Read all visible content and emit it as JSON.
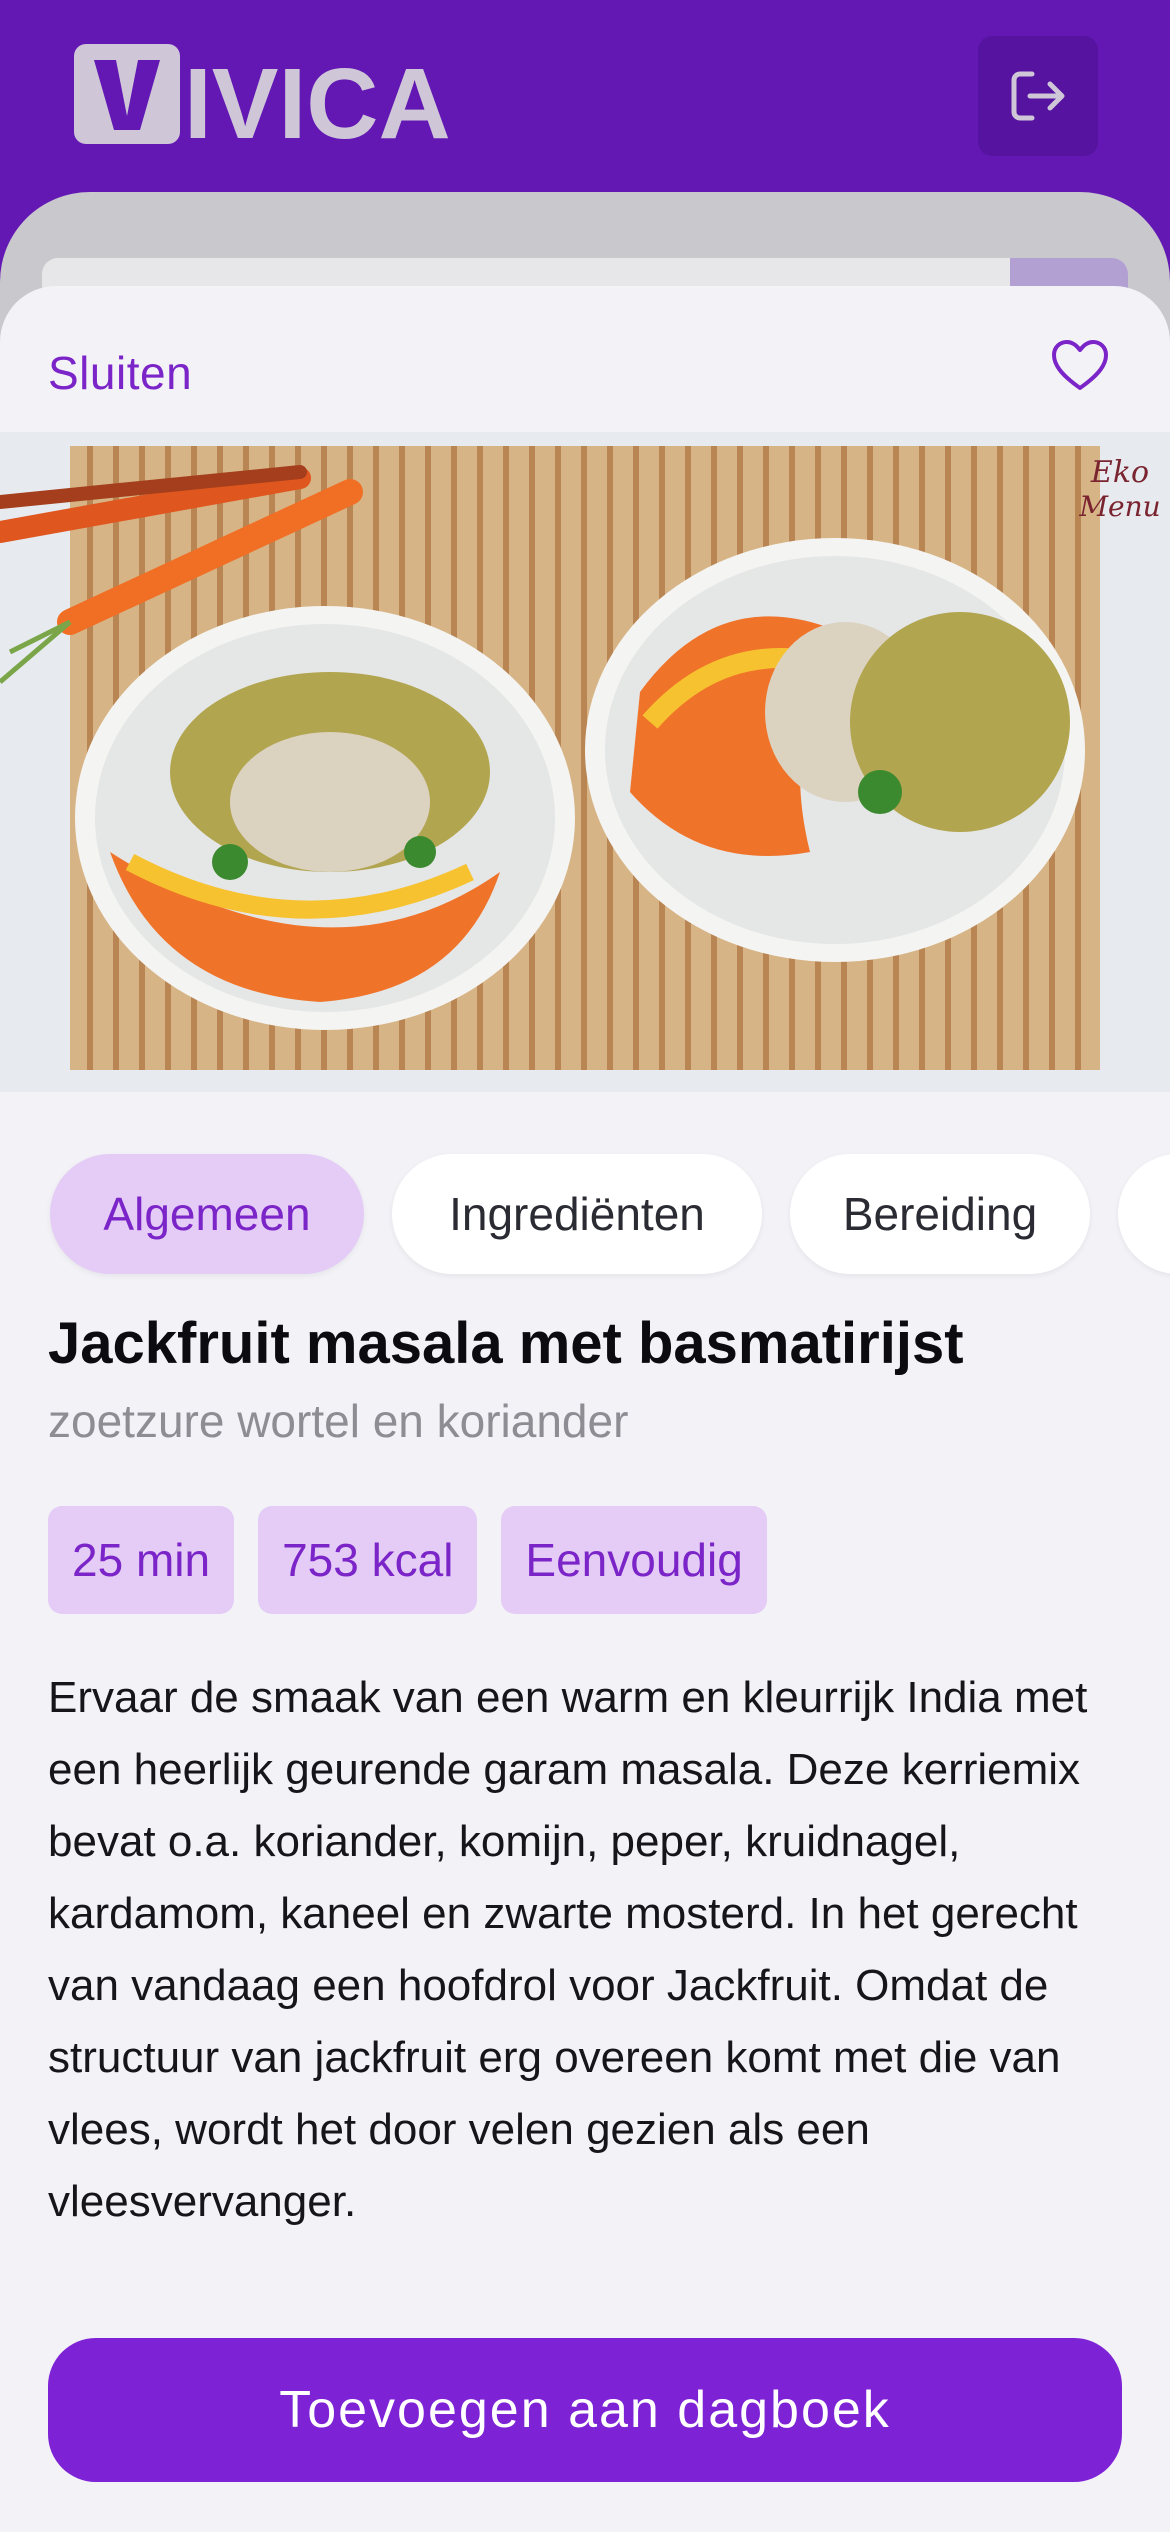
{
  "app": {
    "brand": "VIVICA",
    "logout_icon": "logout-icon"
  },
  "sheet": {
    "close_label": "Sluiten",
    "favorite_icon": "heart-icon",
    "hero_watermark": "Eko Menu"
  },
  "tabs": [
    {
      "label": "Algemeen",
      "active": true
    },
    {
      "label": "Ingrediënten",
      "active": false
    },
    {
      "label": "Bereiding",
      "active": false
    },
    {
      "label": "",
      "active": false
    }
  ],
  "recipe": {
    "title": "Jackfruit masala met basmatirijst",
    "subtitle": "zoetzure wortel en koriander",
    "time": "25 min",
    "calories": "753 kcal",
    "difficulty": "Eenvoudig",
    "description": "Ervaar de smaak van een warm en kleurrijk India met een heerlijk geurende garam masala. Deze kerriemix bevat o.a. koriander, komijn, peper, kruidnagel, kardamom, kaneel en zwarte mosterd. In het gerecht van vandaag een hoofdrol voor Jackfruit. Omdat de structuur van jackfruit erg overeen komt met die van vlees, wordt het door velen gezien als een vleesvervanger."
  },
  "actions": {
    "add_to_diary": "Toevoegen aan dagboek"
  },
  "colors": {
    "brand_purple": "#6318b3",
    "accent_purple": "#7b24c8",
    "badge_bg": "#e4ccf6",
    "sheet_bg": "#f2f2f7"
  }
}
